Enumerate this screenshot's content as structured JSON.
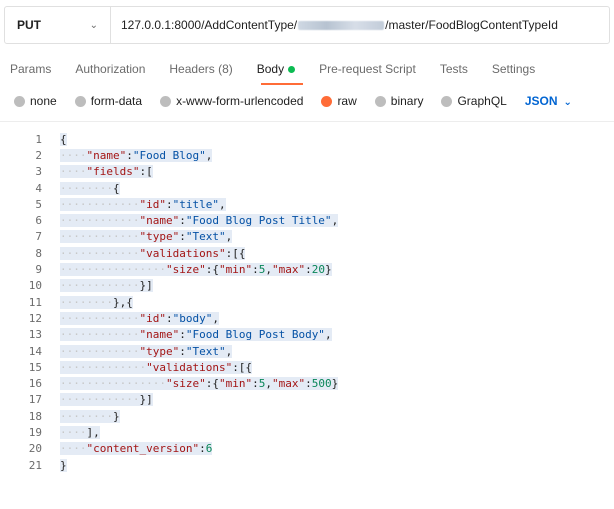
{
  "request": {
    "method": "PUT",
    "url_prefix": "127.0.0.1:8000/AddContentType/",
    "url_suffix": "/master/FoodBlogContentTypeId"
  },
  "tabs": [
    {
      "label": "Params"
    },
    {
      "label": "Authorization"
    },
    {
      "label": "Headers (8)"
    },
    {
      "label": "Body"
    },
    {
      "label": "Pre-request Script"
    },
    {
      "label": "Tests"
    },
    {
      "label": "Settings"
    }
  ],
  "body_types": [
    {
      "label": "none"
    },
    {
      "label": "form-data"
    },
    {
      "label": "x-www-form-urlencoded"
    },
    {
      "label": "raw"
    },
    {
      "label": "binary"
    },
    {
      "label": "GraphQL"
    }
  ],
  "format_selected": "JSON",
  "colors": {
    "accent": "#ff6c37",
    "active_dot": "#0cbb52",
    "json_blue": "#0265d2"
  },
  "code_lines": [
    {
      "n": "1",
      "dots": "",
      "text": "{"
    },
    {
      "n": "2",
      "dots": "····",
      "text": "\"name\":\"Food Blog\","
    },
    {
      "n": "3",
      "dots": "····",
      "text": "\"fields\":["
    },
    {
      "n": "4",
      "dots": "········",
      "text": "{"
    },
    {
      "n": "5",
      "dots": "············",
      "text": "\"id\":\"title\","
    },
    {
      "n": "6",
      "dots": "············",
      "text": "\"name\":\"Food Blog Post Title\","
    },
    {
      "n": "7",
      "dots": "············",
      "text": "\"type\":\"Text\","
    },
    {
      "n": "8",
      "dots": "············",
      "text": "\"validations\":[{"
    },
    {
      "n": "9",
      "dots": "················",
      "text": "\"size\":{\"min\":5,\"max\":20}"
    },
    {
      "n": "10",
      "dots": "············",
      "text": "}]"
    },
    {
      "n": "11",
      "dots": "········",
      "text": "},{"
    },
    {
      "n": "12",
      "dots": "············",
      "text": "\"id\":\"body\","
    },
    {
      "n": "13",
      "dots": "············",
      "text": "\"name\":\"Food Blog Post Body\","
    },
    {
      "n": "14",
      "dots": "············",
      "text": "\"type\":\"Text\","
    },
    {
      "n": "15",
      "dots": "·············",
      "text": "\"validations\":[{"
    },
    {
      "n": "16",
      "dots": "················",
      "text": "\"size\":{\"min\":5,\"max\":500}"
    },
    {
      "n": "17",
      "dots": "············",
      "text": "}]"
    },
    {
      "n": "18",
      "dots": "········",
      "text": "}"
    },
    {
      "n": "19",
      "dots": "····",
      "text": "],"
    },
    {
      "n": "20",
      "dots": "····",
      "text": "\"content_version\":6"
    },
    {
      "n": "21",
      "dots": "",
      "text": "}"
    }
  ]
}
